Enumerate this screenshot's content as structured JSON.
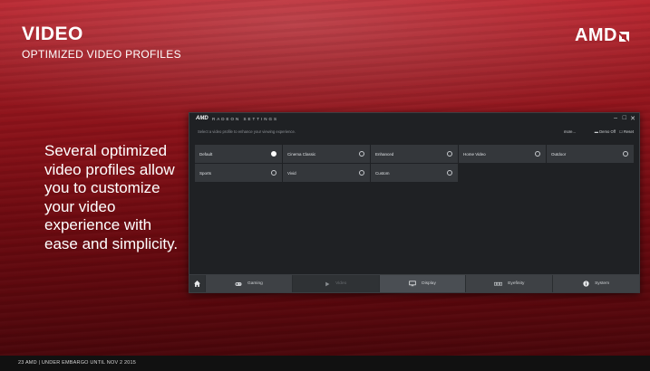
{
  "slide": {
    "title": "VIDEO",
    "subtitle": "OPTIMIZED VIDEO PROFILES",
    "logo": "AMD",
    "body_text": "Several optimized video profiles allow you to customize your video experience with ease and simplicity.",
    "footer": "23  AMD | UNDER EMBARGO UNTIL NOV 2 2015"
  },
  "app": {
    "logo": "AMD",
    "title": "RADEON SETTINGS",
    "hint": "Select a video profile to enhance your viewing experience.",
    "more_label": "more...",
    "demo_label": "Demo Off",
    "reset_label": "Reset",
    "window_controls": {
      "minimize": "–",
      "maximize": "□",
      "close": "✕"
    },
    "profiles": [
      {
        "label": "Default",
        "selected": true
      },
      {
        "label": "Cinema Classic",
        "selected": false
      },
      {
        "label": "Enhanced",
        "selected": false
      },
      {
        "label": "Home Video",
        "selected": false
      },
      {
        "label": "Outdoor",
        "selected": false
      },
      {
        "label": "Sports",
        "selected": false
      },
      {
        "label": "Vivid",
        "selected": false
      },
      {
        "label": "Custom",
        "selected": false
      }
    ],
    "nav": [
      {
        "label": "Gaming",
        "icon": "gamepad-icon"
      },
      {
        "label": "Video",
        "icon": "play-icon"
      },
      {
        "label": "Display",
        "icon": "monitor-icon"
      },
      {
        "label": "Eyefinity",
        "icon": "eyefinity-icon"
      },
      {
        "label": "System",
        "icon": "info-icon"
      }
    ],
    "active_tab": "Display"
  }
}
